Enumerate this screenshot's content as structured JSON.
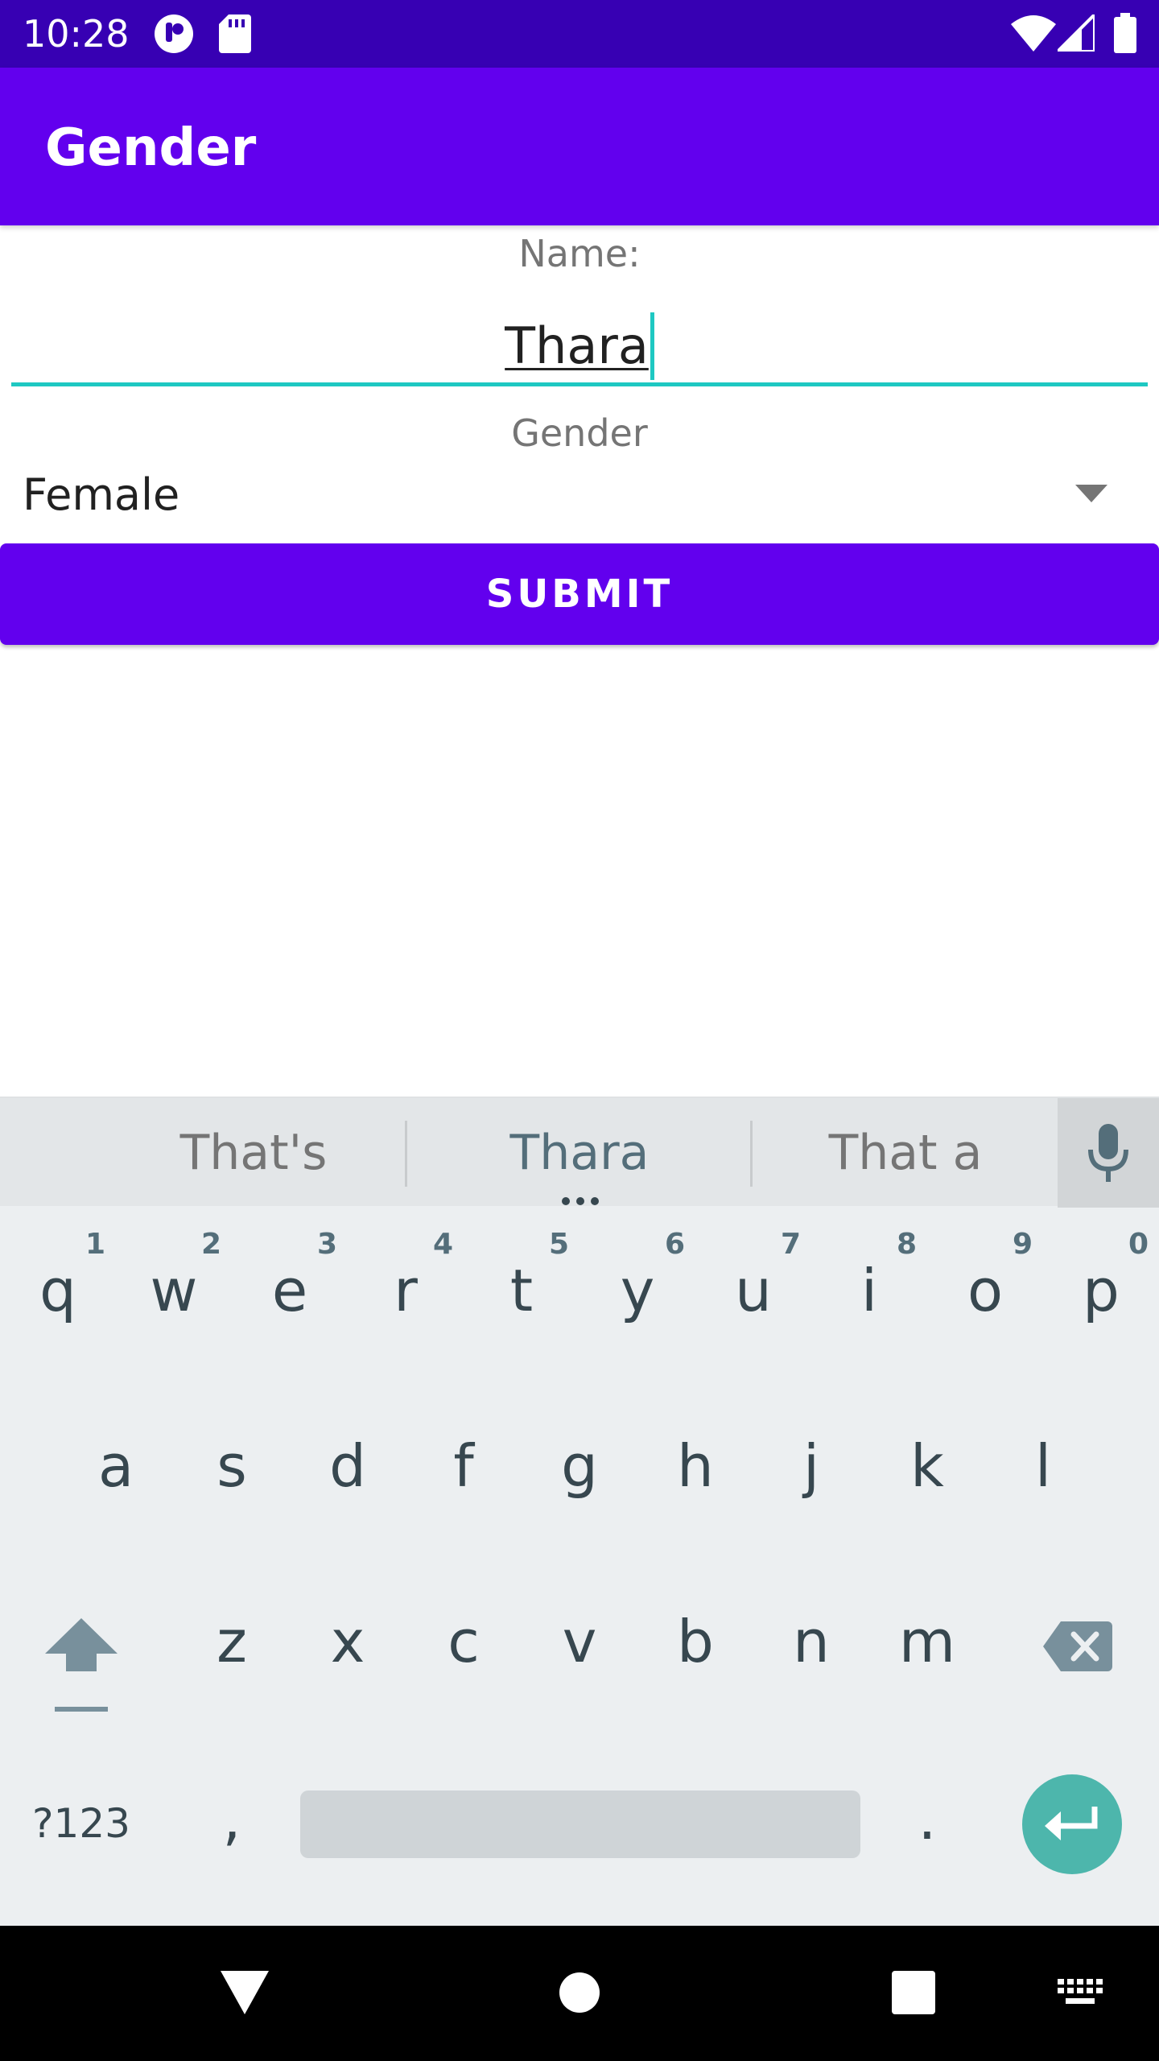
{
  "status_bar": {
    "time": "10:28",
    "icons": [
      "notification-icon",
      "sd-card-icon",
      "wifi-icon",
      "cell-signal-icon",
      "battery-icon"
    ],
    "color": "#3700b3"
  },
  "app_bar": {
    "title": "Gender",
    "color": "#6200ee"
  },
  "form": {
    "name_label": "Name:",
    "name_value": "Thara",
    "gender_label": "Gender",
    "gender_selected": "Female",
    "submit_label": "SUBMIT",
    "accent_color": "#1ec8c2"
  },
  "keyboard": {
    "suggestions": [
      "That's",
      "Thara",
      "That a"
    ],
    "row1": [
      "q",
      "w",
      "e",
      "r",
      "t",
      "y",
      "u",
      "i",
      "o",
      "p"
    ],
    "row1_hints": [
      "1",
      "2",
      "3",
      "4",
      "5",
      "6",
      "7",
      "8",
      "9",
      "0"
    ],
    "row2": [
      "a",
      "s",
      "d",
      "f",
      "g",
      "h",
      "j",
      "k",
      "l"
    ],
    "row3": [
      "z",
      "x",
      "c",
      "v",
      "b",
      "n",
      "m"
    ],
    "symbols_label": "?123",
    "comma": ",",
    "period": ".",
    "enter_color": "#4db6ac"
  },
  "nav_bar": {
    "icons": [
      "back-icon",
      "home-icon",
      "recents-icon",
      "keyboard-switch-icon"
    ]
  }
}
